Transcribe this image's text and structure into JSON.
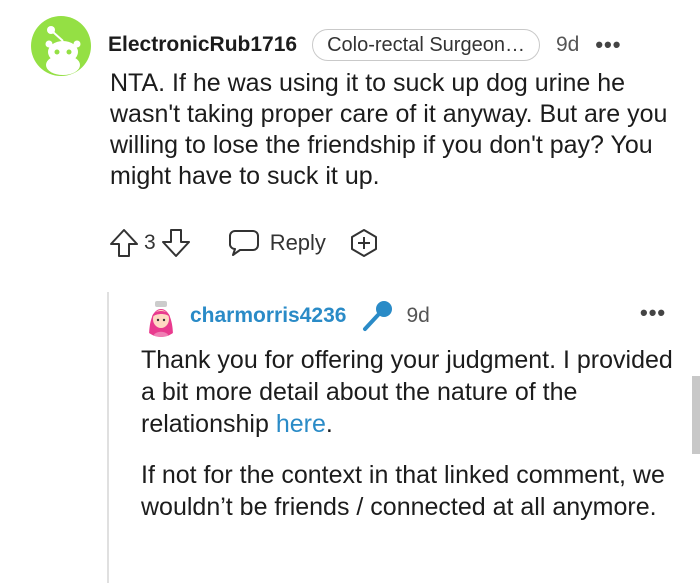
{
  "comment": {
    "username": "ElectronicRub1716",
    "flair": "Colo-rectal Surgeon…",
    "age": "9d",
    "more": "•••",
    "body": "NTA. If he was using it to suck up dog urine he wasn't taking proper care of it anyway. But are you willing to lose the friendship if you don't pay? You might have to suck it up.",
    "score": "3",
    "reply_label": "Reply",
    "icons": {
      "upvote": "arrow-up-icon",
      "downvote": "arrow-down-icon",
      "reply": "speech-bubble-icon",
      "award": "award-plus-icon",
      "avatar": "snoo-avatar"
    }
  },
  "reply": {
    "username": "charmorris4236",
    "age": "9d",
    "more": "•••",
    "p1_before_link": "Thank you for offering your judgment. I provided a bit more detail about the nature of the relationship ",
    "p1_link": "here",
    "p1_after_link": ".",
    "p2": "If not for the context in that linked comment, we wouldn’t be friends / connected at all anymore.",
    "icons": {
      "avatar": "pink-hair-avatar",
      "mic": "microphone-icon"
    }
  },
  "colors": {
    "avatar_bg": "#94e044",
    "link": "#2a8bc7",
    "mic": "#2a8bc7"
  }
}
